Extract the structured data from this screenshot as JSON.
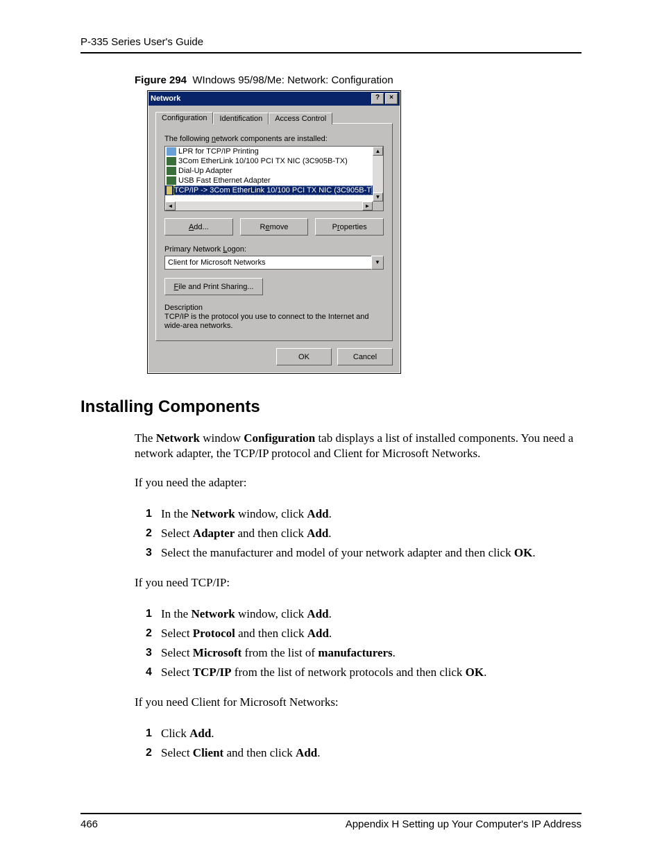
{
  "header": {
    "guide_title": "P-335 Series User's Guide"
  },
  "figure": {
    "label": "Figure 294",
    "caption": "WIndows 95/98/Me: Network: Configuration"
  },
  "dialog": {
    "title": "Network",
    "tabs": {
      "configuration": "Configuration",
      "identification": "Identification",
      "access": "Access Control"
    },
    "list_label": "The following network components are installed:",
    "items": {
      "i0": "LPR for TCP/IP Printing",
      "i1": "3Com EtherLink 10/100 PCI TX NIC (3C905B-TX)",
      "i2": "Dial-Up Adapter",
      "i3": "USB Fast Ethernet Adapter",
      "i4": "TCP/IP -> 3Com EtherLink 10/100 PCI TX NIC (3C905B-T"
    },
    "buttons": {
      "add": "Add...",
      "remove": "Remove",
      "properties": "Properties"
    },
    "logon_label": "Primary Network Logon:",
    "logon_value": "Client for Microsoft Networks",
    "share_btn": "File and Print Sharing...",
    "desc_label": "Description",
    "desc_text": "TCP/IP is the protocol you use to connect to the Internet and wide-area networks.",
    "ok": "OK",
    "cancel": "Cancel"
  },
  "section": {
    "heading": "Installing Components"
  },
  "body": {
    "p1a": "The ",
    "p1b": "Network",
    "p1c": " window ",
    "p1d": "Configuration",
    "p1e": " tab displays a list of installed components. You need a network adapter, the TCP/IP protocol and Client for Microsoft Networks.",
    "p2": "If you need the adapter:",
    "p3": "If you need TCP/IP:",
    "p4": "If you need Client for Microsoft Networks:"
  },
  "list1": {
    "l1a": "In the ",
    "l1b": "Network",
    "l1c": " window, click ",
    "l1d": "Add",
    "l1e": ".",
    "l2a": "Select ",
    "l2b": "Adapter",
    "l2c": " and then click ",
    "l2d": "Add",
    "l2e": ".",
    "l3a": "Select the manufacturer and model of your network adapter and then click ",
    "l3b": "OK",
    "l3c": "."
  },
  "list2": {
    "l1a": "In the ",
    "l1b": "Network",
    "l1c": " window, click ",
    "l1d": "Add",
    "l1e": ".",
    "l2a": "Select ",
    "l2b": "Protocol",
    "l2c": " and then click ",
    "l2d": "Add",
    "l2e": ".",
    "l3a": "Select ",
    "l3b": "Microsoft",
    "l3c": " from the list of ",
    "l3d": "manufacturers",
    "l3e": ".",
    "l4a": "Select ",
    "l4b": "TCP/IP",
    "l4c": " from the list of network protocols and then click ",
    "l4d": "OK",
    "l4e": "."
  },
  "list3": {
    "l1a": "Click ",
    "l1b": "Add",
    "l1c": ".",
    "l2a": "Select ",
    "l2b": "Client",
    "l2c": " and then click ",
    "l2d": "Add",
    "l2e": "."
  },
  "footer": {
    "page": "466",
    "appendix": "Appendix H Setting up Your Computer's IP Address"
  }
}
